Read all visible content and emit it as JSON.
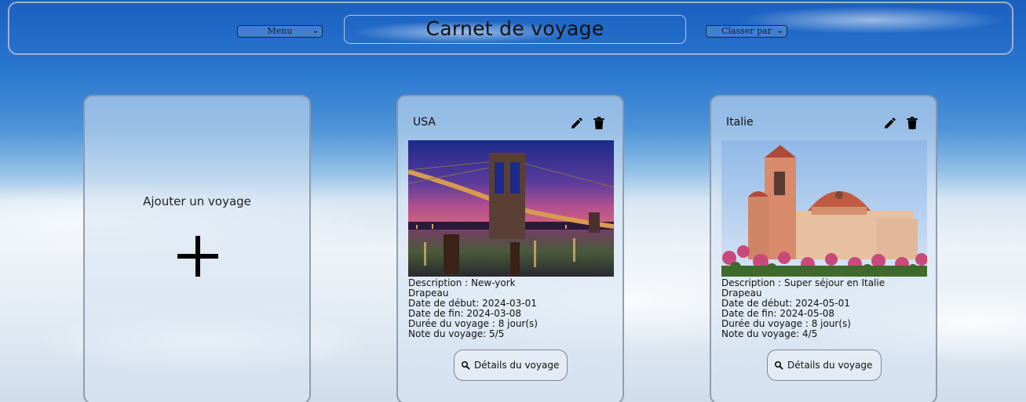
{
  "header": {
    "title": "Carnet de voyage",
    "menu_select": "Menu",
    "sort_select": "Classer par"
  },
  "add_card": {
    "label": "Ajouter un voyage",
    "icon": "plus-icon"
  },
  "trips": [
    {
      "country": "USA",
      "image": "brooklyn-bridge-night-photo",
      "description": "Description : New-york",
      "flag": "Drapeau",
      "start": "Date de début: 2024-03-01",
      "end": "Date de fin: 2024-03-08",
      "duration": "Durée du voyage : 8 jour(s)",
      "rating": "Note du voyage: 5/5",
      "details_label": "Détails du voyage"
    },
    {
      "country": "Italie",
      "image": "church-with-flowers-photo",
      "description": "Description : Super séjour en Italie",
      "flag": "Drapeau",
      "start": "Date de début: 2024-05-01",
      "end": "Date de fin: 2024-05-08",
      "duration": "Durée du voyage : 8 jour(s)",
      "rating": "Note du voyage: 4/5",
      "details_label": "Détails du voyage"
    }
  ],
  "icons": {
    "edit": "pencil-icon",
    "delete": "trash-icon",
    "search": "magnifier-icon"
  }
}
